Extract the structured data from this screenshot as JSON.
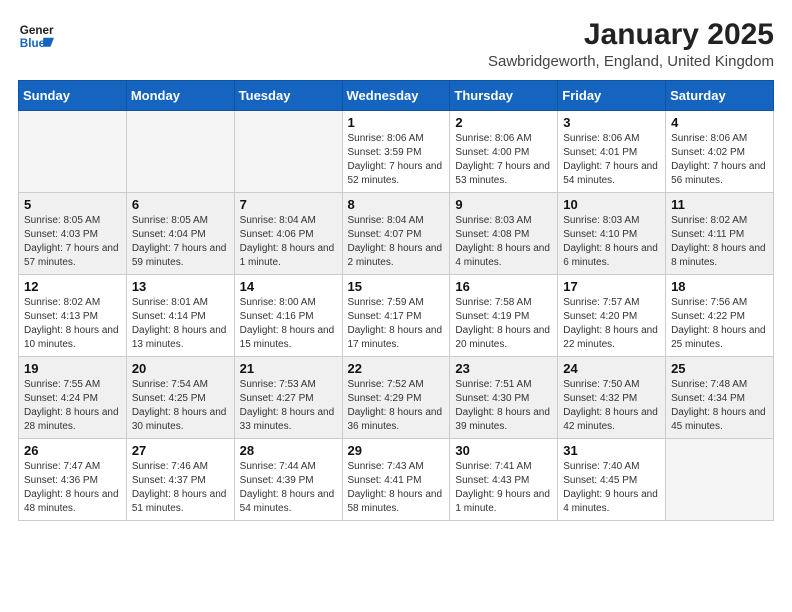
{
  "header": {
    "logo_line1": "General",
    "logo_line2": "Blue",
    "month": "January 2025",
    "location": "Sawbridgeworth, England, United Kingdom"
  },
  "days_of_week": [
    "Sunday",
    "Monday",
    "Tuesday",
    "Wednesday",
    "Thursday",
    "Friday",
    "Saturday"
  ],
  "weeks": [
    [
      {
        "day": "",
        "info": ""
      },
      {
        "day": "",
        "info": ""
      },
      {
        "day": "",
        "info": ""
      },
      {
        "day": "1",
        "info": "Sunrise: 8:06 AM\nSunset: 3:59 PM\nDaylight: 7 hours and 52 minutes."
      },
      {
        "day": "2",
        "info": "Sunrise: 8:06 AM\nSunset: 4:00 PM\nDaylight: 7 hours and 53 minutes."
      },
      {
        "day": "3",
        "info": "Sunrise: 8:06 AM\nSunset: 4:01 PM\nDaylight: 7 hours and 54 minutes."
      },
      {
        "day": "4",
        "info": "Sunrise: 8:06 AM\nSunset: 4:02 PM\nDaylight: 7 hours and 56 minutes."
      }
    ],
    [
      {
        "day": "5",
        "info": "Sunrise: 8:05 AM\nSunset: 4:03 PM\nDaylight: 7 hours and 57 minutes."
      },
      {
        "day": "6",
        "info": "Sunrise: 8:05 AM\nSunset: 4:04 PM\nDaylight: 7 hours and 59 minutes."
      },
      {
        "day": "7",
        "info": "Sunrise: 8:04 AM\nSunset: 4:06 PM\nDaylight: 8 hours and 1 minute."
      },
      {
        "day": "8",
        "info": "Sunrise: 8:04 AM\nSunset: 4:07 PM\nDaylight: 8 hours and 2 minutes."
      },
      {
        "day": "9",
        "info": "Sunrise: 8:03 AM\nSunset: 4:08 PM\nDaylight: 8 hours and 4 minutes."
      },
      {
        "day": "10",
        "info": "Sunrise: 8:03 AM\nSunset: 4:10 PM\nDaylight: 8 hours and 6 minutes."
      },
      {
        "day": "11",
        "info": "Sunrise: 8:02 AM\nSunset: 4:11 PM\nDaylight: 8 hours and 8 minutes."
      }
    ],
    [
      {
        "day": "12",
        "info": "Sunrise: 8:02 AM\nSunset: 4:13 PM\nDaylight: 8 hours and 10 minutes."
      },
      {
        "day": "13",
        "info": "Sunrise: 8:01 AM\nSunset: 4:14 PM\nDaylight: 8 hours and 13 minutes."
      },
      {
        "day": "14",
        "info": "Sunrise: 8:00 AM\nSunset: 4:16 PM\nDaylight: 8 hours and 15 minutes."
      },
      {
        "day": "15",
        "info": "Sunrise: 7:59 AM\nSunset: 4:17 PM\nDaylight: 8 hours and 17 minutes."
      },
      {
        "day": "16",
        "info": "Sunrise: 7:58 AM\nSunset: 4:19 PM\nDaylight: 8 hours and 20 minutes."
      },
      {
        "day": "17",
        "info": "Sunrise: 7:57 AM\nSunset: 4:20 PM\nDaylight: 8 hours and 22 minutes."
      },
      {
        "day": "18",
        "info": "Sunrise: 7:56 AM\nSunset: 4:22 PM\nDaylight: 8 hours and 25 minutes."
      }
    ],
    [
      {
        "day": "19",
        "info": "Sunrise: 7:55 AM\nSunset: 4:24 PM\nDaylight: 8 hours and 28 minutes."
      },
      {
        "day": "20",
        "info": "Sunrise: 7:54 AM\nSunset: 4:25 PM\nDaylight: 8 hours and 30 minutes."
      },
      {
        "day": "21",
        "info": "Sunrise: 7:53 AM\nSunset: 4:27 PM\nDaylight: 8 hours and 33 minutes."
      },
      {
        "day": "22",
        "info": "Sunrise: 7:52 AM\nSunset: 4:29 PM\nDaylight: 8 hours and 36 minutes."
      },
      {
        "day": "23",
        "info": "Sunrise: 7:51 AM\nSunset: 4:30 PM\nDaylight: 8 hours and 39 minutes."
      },
      {
        "day": "24",
        "info": "Sunrise: 7:50 AM\nSunset: 4:32 PM\nDaylight: 8 hours and 42 minutes."
      },
      {
        "day": "25",
        "info": "Sunrise: 7:48 AM\nSunset: 4:34 PM\nDaylight: 8 hours and 45 minutes."
      }
    ],
    [
      {
        "day": "26",
        "info": "Sunrise: 7:47 AM\nSunset: 4:36 PM\nDaylight: 8 hours and 48 minutes."
      },
      {
        "day": "27",
        "info": "Sunrise: 7:46 AM\nSunset: 4:37 PM\nDaylight: 8 hours and 51 minutes."
      },
      {
        "day": "28",
        "info": "Sunrise: 7:44 AM\nSunset: 4:39 PM\nDaylight: 8 hours and 54 minutes."
      },
      {
        "day": "29",
        "info": "Sunrise: 7:43 AM\nSunset: 4:41 PM\nDaylight: 8 hours and 58 minutes."
      },
      {
        "day": "30",
        "info": "Sunrise: 7:41 AM\nSunset: 4:43 PM\nDaylight: 9 hours and 1 minute."
      },
      {
        "day": "31",
        "info": "Sunrise: 7:40 AM\nSunset: 4:45 PM\nDaylight: 9 hours and 4 minutes."
      },
      {
        "day": "",
        "info": ""
      }
    ]
  ]
}
